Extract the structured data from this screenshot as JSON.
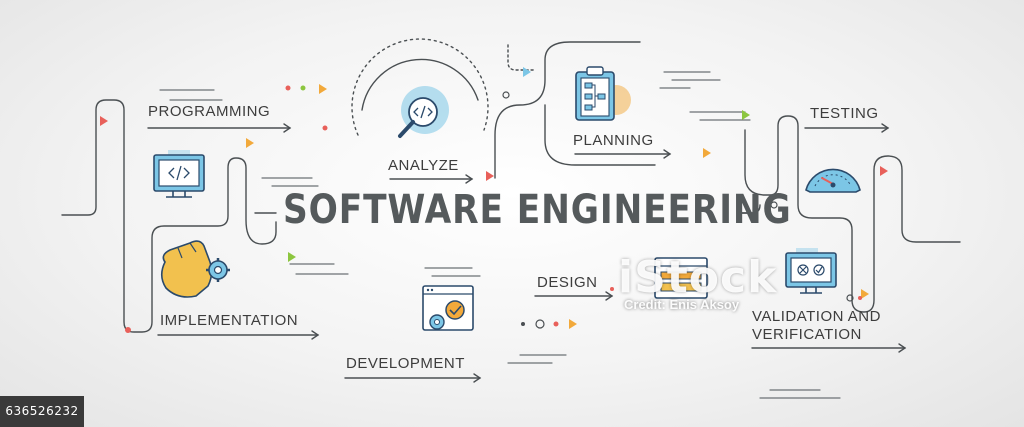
{
  "title": "SOFTWARE ENGINEERING",
  "stages": {
    "programming": "PROGRAMMING",
    "analyze": "ANALYZE",
    "planning": "PLANNING",
    "testing": "TESTING",
    "implementation": "IMPLEMENTATION",
    "development": "DEVELOPMENT",
    "design": "DESIGN",
    "validation_line1": "VALIDATION AND",
    "validation_line2": "VERIFICATION"
  },
  "icons": {
    "programming": "monitor-code-icon",
    "analyze": "magnifier-code-icon",
    "planning": "clipboard-flowchart-icon",
    "testing": "speedometer-gauge-icon",
    "implementation": "hand-gear-icon",
    "development": "browser-gear-check-icon",
    "design": "layout-window-icon",
    "validation": "monitor-check-icon"
  },
  "colors": {
    "line": "#4a4f52",
    "accent_blue": "#7cc6e6",
    "accent_orange": "#f2a93b",
    "accent_green": "#8cc63f",
    "accent_red": "#e8605a",
    "icon_outline": "#2b4a6b"
  },
  "watermark": {
    "logo": "iStock",
    "credit": "Credit: Enis Aksoy"
  },
  "image_id": "636526232"
}
